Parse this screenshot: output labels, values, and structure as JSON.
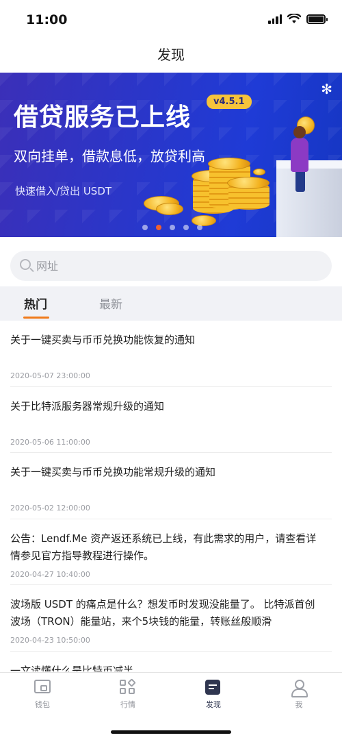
{
  "status_bar": {
    "time": "11:00"
  },
  "nav": {
    "title": "发现"
  },
  "banner": {
    "title": "借贷服务已上线",
    "version": "v4.5.1",
    "subtitle": "双向挂单，借款息低，放贷利高",
    "note": "快速借入/贷出 USDT",
    "page_count": 5,
    "active_page": 2
  },
  "search": {
    "placeholder": "网址",
    "value": ""
  },
  "tabs": [
    {
      "label": "热门",
      "active": true
    },
    {
      "label": "最新",
      "active": false
    }
  ],
  "news": [
    {
      "title": "关于一键买卖与币币兑换功能恢复的通知",
      "date": "2020-05-07 23:00:00"
    },
    {
      "title": "关于比特派服务器常规升级的通知",
      "date": "2020-05-06 11:00:00"
    },
    {
      "title": "关于一键买卖与币币兑换功能常规升级的通知",
      "date": "2020-05-02 12:00:00"
    },
    {
      "title": "公告：Lendf.Me 资产返还系统已上线，有此需求的用户，请查看详情参见官方指导教程进行操作。",
      "date": "2020-04-27 10:40:00"
    },
    {
      "title": "波场版 USDT 的痛点是什么？想发币时发现没能量了。 比特派首创波场（TRON）能量站，来个5块钱的能量，转账丝般顺滑",
      "date": "2020-04-23 10:50:00"
    },
    {
      "title": "一文读懂什么是比特币减半",
      "date": ""
    }
  ],
  "tab_bar": {
    "items": [
      {
        "label": "钱包",
        "icon": "wallet-icon"
      },
      {
        "label": "行情",
        "icon": "market-icon"
      },
      {
        "label": "发现",
        "icon": "discover-icon"
      },
      {
        "label": "我",
        "icon": "profile-icon"
      }
    ],
    "active_index": 2
  },
  "colors": {
    "accent": "#f07a1a",
    "banner_blue": "#2a36c9",
    "tab_active": "#2f3650"
  }
}
